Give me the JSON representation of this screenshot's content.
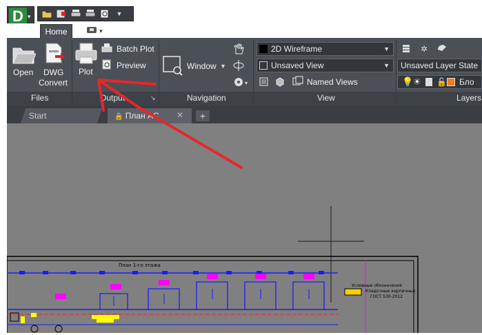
{
  "app": {
    "logo_letter": "D"
  },
  "ribbon_tabs": {
    "home": "Home"
  },
  "files_panel": {
    "title": "Files",
    "open": "Open",
    "dwg_convert_line1": "DWG",
    "dwg_convert_line2": "Convert"
  },
  "output_panel": {
    "title": "Output",
    "plot": "Plot",
    "batch_plot": "Batch Plot",
    "preview": "Preview"
  },
  "navigation_panel": {
    "title": "Navigation",
    "window": "Window"
  },
  "view_panel": {
    "title": "View",
    "visual_style": "2D Wireframe",
    "view_dropdown": "Unsaved View",
    "named_views": "Named Views"
  },
  "layers_panel": {
    "title": "Layers",
    "layer_state": "Unsaved Layer State",
    "layer_name": "Бло"
  },
  "doc_tabs": {
    "start": "Start",
    "plan": "План АС",
    "add": "+"
  },
  "drawing": {
    "title": "План 1-го этажа",
    "note_line1": "Условные обозначения",
    "note_line2": "Кладочные кирпичные",
    "note_line3": "ГОСТ 530-2012"
  },
  "colors": {
    "ribbon": "#4b5057",
    "canvas": "#808080",
    "annotation_arrow": "#e8262b",
    "drawing_lines": "#1a1aff",
    "magenta": "#ff00ff"
  }
}
